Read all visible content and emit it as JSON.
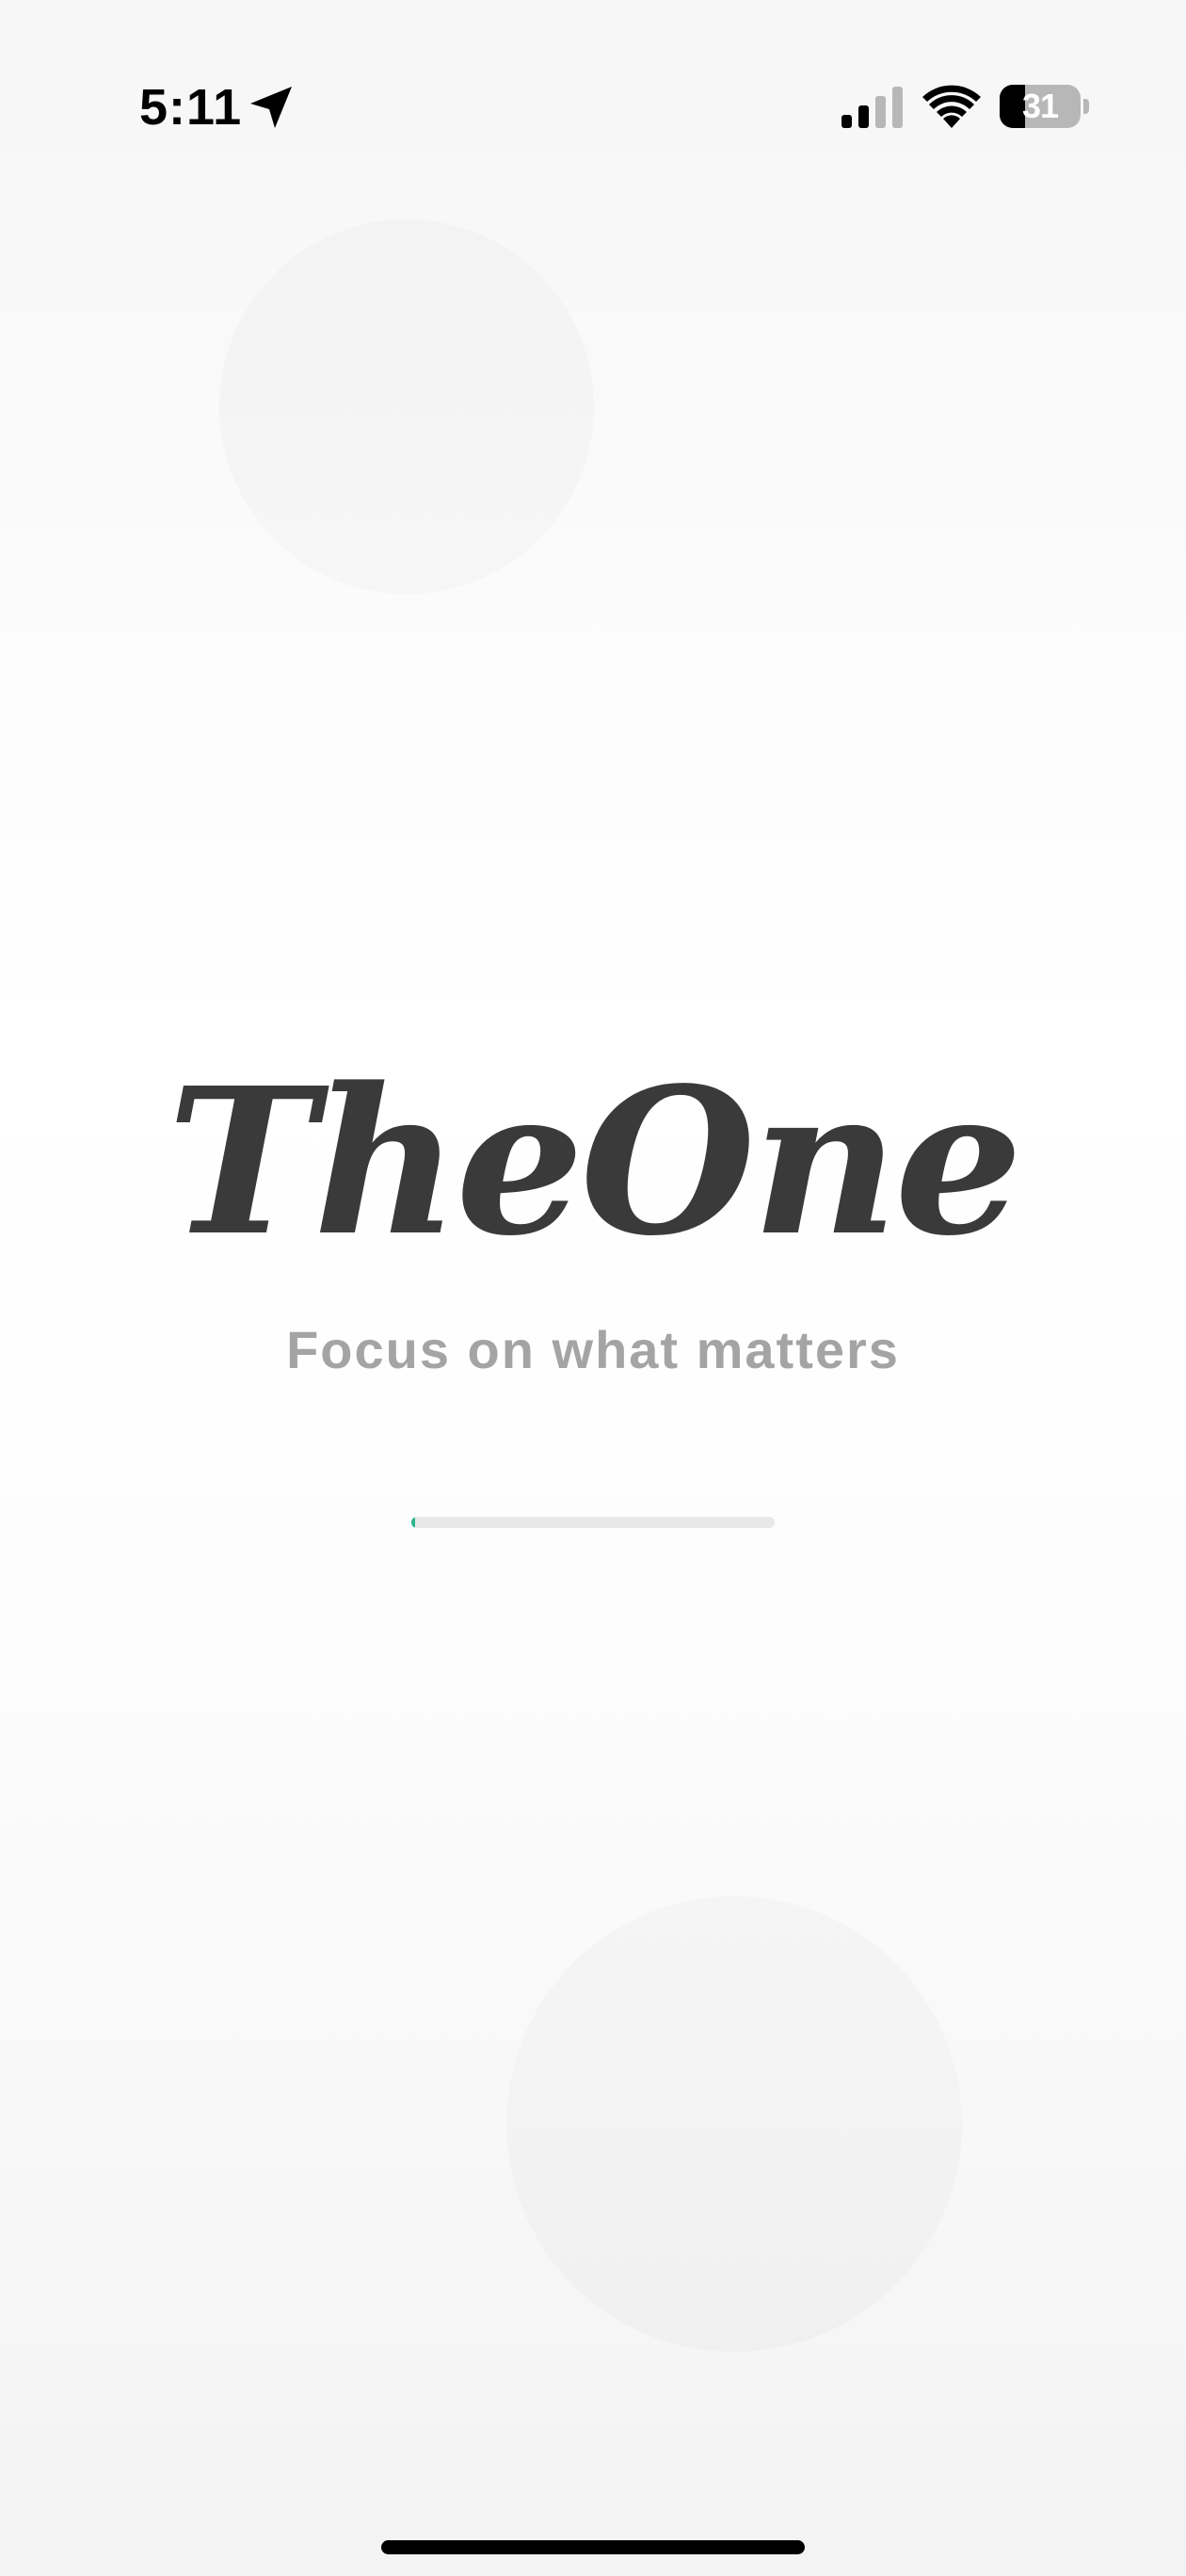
{
  "status_bar": {
    "time": "5:11",
    "location_icon": "location-arrow-icon",
    "signal_icon": "cellular-signal-icon",
    "signal_bars_active": 2,
    "signal_bars_total": 4,
    "wifi_icon": "wifi-icon",
    "battery_icon": "battery-icon",
    "battery_level": "31",
    "battery_fraction": 0.31
  },
  "splash": {
    "logo_text": "TheOne",
    "tagline": "Focus on what matters",
    "loading_progress_fraction": 0.01
  },
  "colors": {
    "logo": "#3a3a3a",
    "tagline": "#a4a4a4",
    "progress_track": "#e8e8e8",
    "progress_fill": "#2bb38a"
  }
}
